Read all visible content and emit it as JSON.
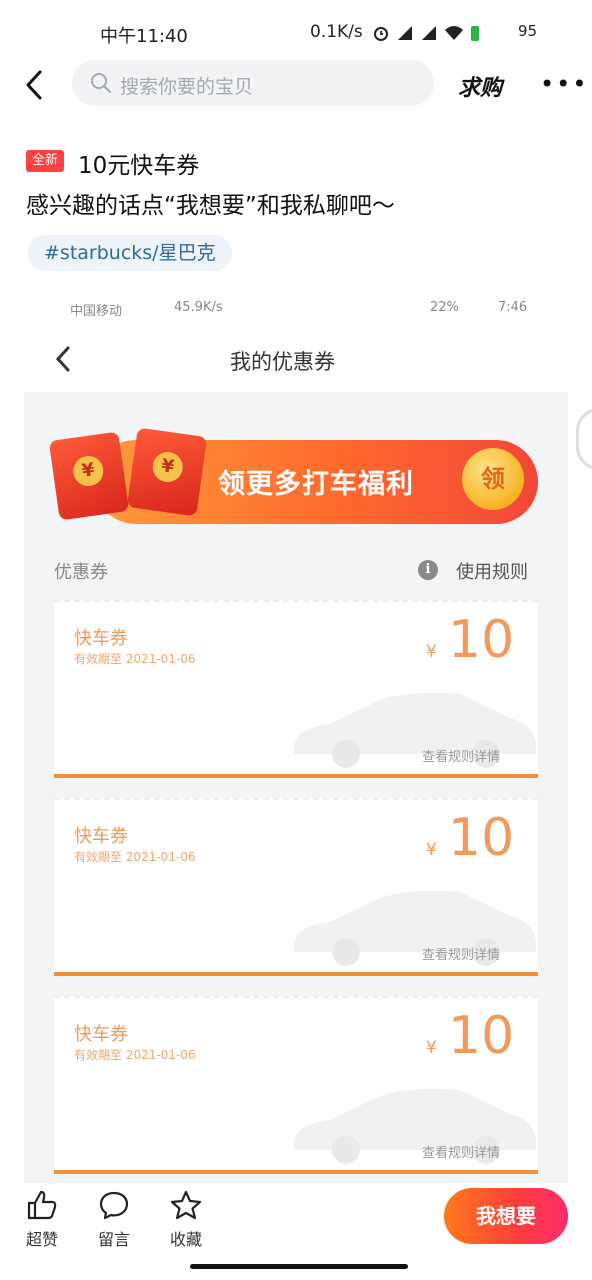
{
  "status_bar": {
    "time": "中午11:40",
    "speed": "0.1K/s",
    "battery": "95"
  },
  "nav": {
    "search_placeholder": "搜索你要的宝贝",
    "title": "求购",
    "more": "•••"
  },
  "listing": {
    "badge": "全新",
    "title_line1": "10元快车券",
    "title_line2": "感兴趣的话点“我想要”和我私聊吧～",
    "tag": "#starbucks/星巴克"
  },
  "embedded": {
    "status_left": "中国移动",
    "status_speed": "45.9K/s",
    "status_battery": "22%",
    "status_time": "7:46",
    "page_title": "我的优惠券",
    "banner_text": "领更多打车福利",
    "banner_button": "领",
    "section_label": "优惠券",
    "rules_label": "使用规则",
    "coupons": [
      {
        "name": "快车券",
        "expiry": "有效期至 2021-01-06",
        "currency": "¥",
        "amount": "10",
        "details": "查看规则详情"
      },
      {
        "name": "快车券",
        "expiry": "有效期至 2021-01-06",
        "currency": "¥",
        "amount": "10",
        "details": "查看规则详情"
      },
      {
        "name": "快车券",
        "expiry": "有效期至 2021-01-06",
        "currency": "¥",
        "amount": "10",
        "details": "查看规则详情"
      }
    ]
  },
  "bottom_bar": {
    "like_label": "超赞",
    "comment_label": "留言",
    "favorite_label": "收藏",
    "want_label": "我想要"
  },
  "colors": {
    "accent": "#ff4040",
    "coupon_orange": "#f0913a",
    "tag_text": "#2f6a98"
  }
}
